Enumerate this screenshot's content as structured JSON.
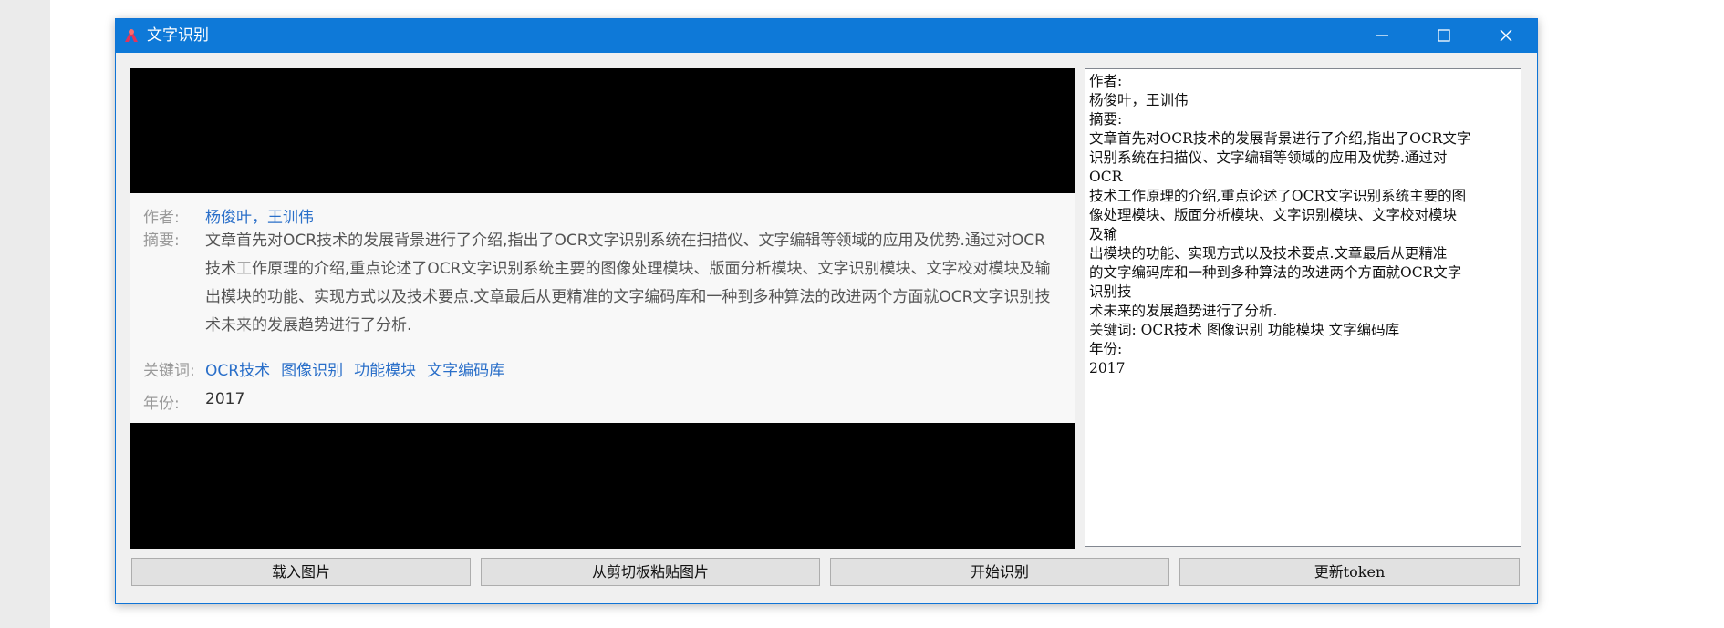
{
  "window": {
    "title": "文字识别",
    "icon": "app-logo-icon",
    "controls": [
      "minimize-icon",
      "maximize-icon",
      "close-icon"
    ]
  },
  "image_panel": {
    "card": {
      "author_label": "作者:",
      "author_value": "杨俊叶，王训伟",
      "abstract_label": "摘要:",
      "abstract_lines": [
        "文章首先对OCR技术的发展背景进行了介绍,指出了OCR文字识别系统在扫描仪、文字编辑等领域的应用及优势.通过对OCR",
        "技术工作原理的介绍,重点论述了OCR文字识别系统主要的图像处理模块、版面分析模块、文字识别模块、文字校对模块及输",
        "出模块的功能、实现方式以及技术要点.文章最后从更精准的文字编码库和一种到多种算法的改进两个方面就OCR文字识别技",
        "术未来的发展趋势进行了分析."
      ],
      "keywords_label": "关键词:",
      "keywords": [
        "OCR技术",
        "图像识别",
        "功能模块",
        "文字编码库"
      ],
      "year_label": "年份:",
      "year_value": "2017"
    }
  },
  "ocr_result": {
    "lines": [
      "作者:",
      "杨俊叶，王训伟",
      "摘要:",
      "文章首先对OCR技术的发展背景进行了介绍,指出了OCR文字",
      "识别系统在扫描仪、文字编辑等领域的应用及优势.通过对",
      "OCR",
      "技术工作原理的介绍,重点论述了OCR文字识别系统主要的图",
      "像处理模块、版面分析模块、文字识别模块、文字校对模块",
      "及输",
      "出模块的功能、实现方式以及技术要点.文章最后从更精准",
      "的文字编码库和一种到多种算法的改进两个方面就OCR文字",
      "识别技",
      "术未来的发展趋势进行了分析.",
      "关键词: OCR技术 图像识别 功能模块 文字编码库",
      "年份:",
      "2017"
    ]
  },
  "buttons": {
    "load_image": "载入图片",
    "paste_clipboard": "从剪切板粘贴图片",
    "start_recognition": "开始识别",
    "update_token": "更新token"
  },
  "colors": {
    "titlebar": "#0e79d8",
    "link": "#2a6fc9",
    "window_bg": "#f0f0f0"
  }
}
